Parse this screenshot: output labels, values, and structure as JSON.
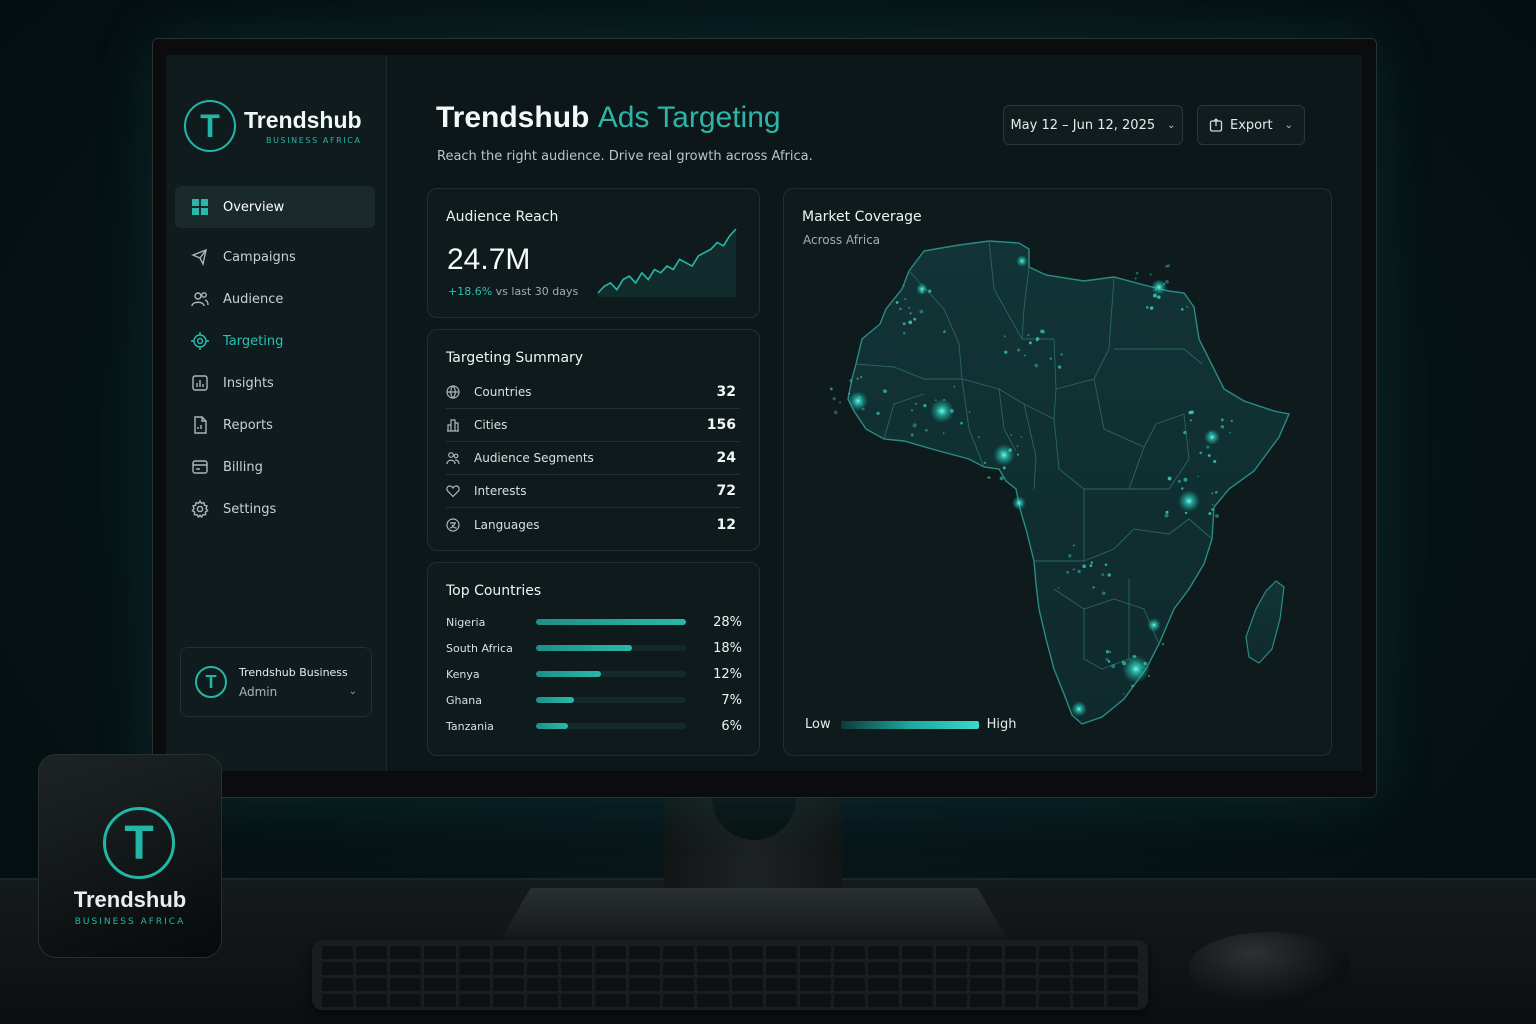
{
  "brand": {
    "name": "Trendshub",
    "sub": "BUSINESS AFRICA",
    "initial": "T"
  },
  "nav": [
    {
      "label": "Overview",
      "icon": "grid-icon"
    },
    {
      "label": "Campaigns",
      "icon": "megaphone-icon"
    },
    {
      "label": "Audience",
      "icon": "users-icon"
    },
    {
      "label": "Targeting",
      "icon": "target-icon"
    },
    {
      "label": "Insights",
      "icon": "bar-chart-icon"
    },
    {
      "label": "Reports",
      "icon": "document-icon"
    },
    {
      "label": "Billing",
      "icon": "card-icon"
    },
    {
      "label": "Settings",
      "icon": "gear-icon"
    }
  ],
  "account": {
    "name": "Trendshub Business",
    "role": "Admin",
    "initial": "T"
  },
  "header": {
    "title_main": "Trendshub",
    "title_accent": "Ads Targeting",
    "subtitle": "Reach the right audience. Drive real growth across Africa.",
    "date_range": "May 12 – Jun 12, 2025",
    "export_label": "Export"
  },
  "reach": {
    "title": "Audience Reach",
    "value": "24.7M",
    "delta": "+18.6%",
    "delta_suffix": "vs last 30 days",
    "sparkline": [
      2,
      4,
      5,
      3,
      6,
      7,
      5,
      8,
      6,
      9,
      8,
      10,
      9,
      12,
      11,
      10,
      13,
      14,
      15,
      17,
      16,
      19,
      21
    ]
  },
  "summary": {
    "title": "Targeting Summary",
    "rows": [
      {
        "label": "Countries",
        "value": "32",
        "icon": "globe-icon"
      },
      {
        "label": "Cities",
        "value": "156",
        "icon": "city-icon"
      },
      {
        "label": "Audience Segments",
        "value": "24",
        "icon": "segments-icon"
      },
      {
        "label": "Interests",
        "value": "72",
        "icon": "heart-icon"
      },
      {
        "label": "Languages",
        "value": "12",
        "icon": "language-icon"
      }
    ]
  },
  "top_countries": {
    "title": "Top Countries",
    "rows": [
      {
        "name": "Nigeria",
        "pct": "28%",
        "share": 28
      },
      {
        "name": "South Africa",
        "pct": "18%",
        "share": 18
      },
      {
        "name": "Kenya",
        "pct": "12%",
        "share": 12
      },
      {
        "name": "Ghana",
        "pct": "7%",
        "share": 7
      },
      {
        "name": "Tanzania",
        "pct": "6%",
        "share": 6
      }
    ]
  },
  "map": {
    "title": "Market Coverage",
    "subtitle": "Across Africa",
    "legend_low": "Low",
    "legend_high": "High"
  },
  "box": {
    "name": "Trendshub",
    "sub": "BUSINESS AFRICA",
    "initial": "T"
  },
  "colors": {
    "accent": "#2ab7a9",
    "background": "#0d1719",
    "card": "#0f1a1c"
  }
}
